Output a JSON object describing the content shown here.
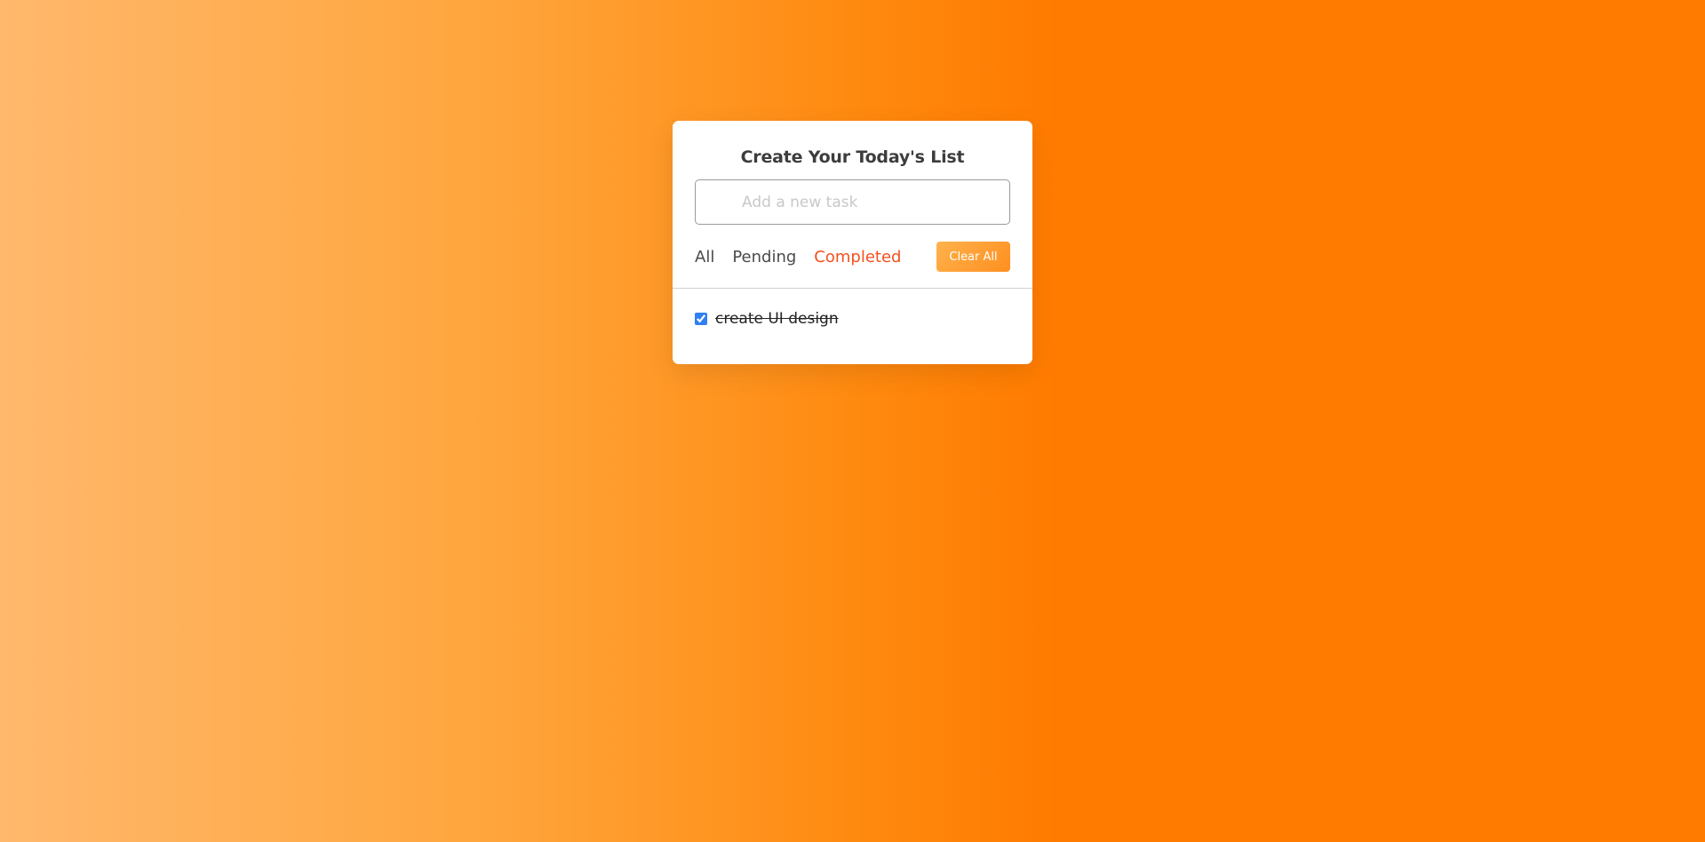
{
  "app": {
    "title": "Create Your Today's List"
  },
  "input": {
    "placeholder": "Add a new task",
    "value": ""
  },
  "filters": [
    {
      "label": "All",
      "active": false
    },
    {
      "label": "Pending",
      "active": false
    },
    {
      "label": "Completed",
      "active": true
    }
  ],
  "clear_button": {
    "label": "Clear All"
  },
  "tasks": [
    {
      "text": "create UI design",
      "completed": true
    }
  ],
  "colors": {
    "active_filter": "#f4511e",
    "accent": "#ff7b00",
    "checkbox": "#2f7ff5"
  }
}
